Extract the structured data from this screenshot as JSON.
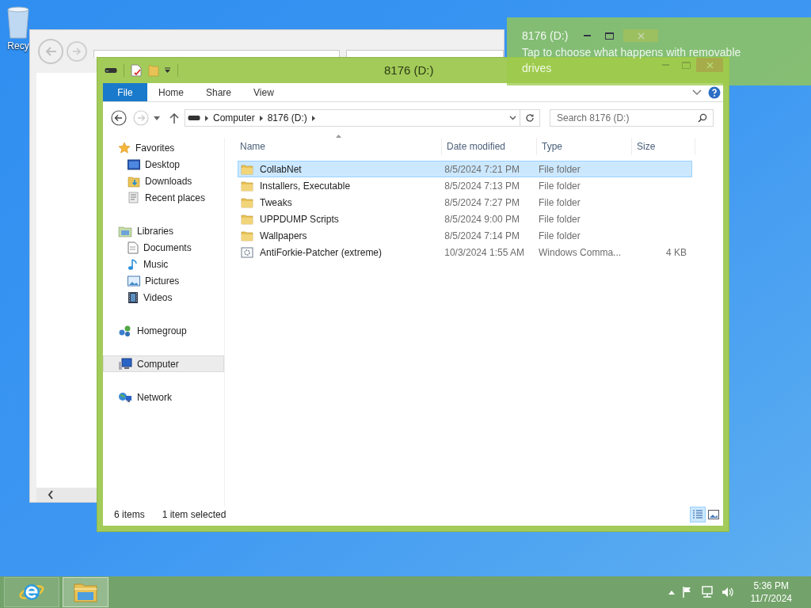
{
  "desktop_icons": [
    {
      "label": "Recy"
    }
  ],
  "explorer": {
    "title": "8176 (D:)",
    "ribbon_tabs": [
      {
        "label": "File",
        "kind": "file"
      },
      {
        "label": "Home",
        "kind": "tab"
      },
      {
        "label": "Share",
        "kind": "tab"
      },
      {
        "label": "View",
        "kind": "tab"
      }
    ],
    "address": [
      "Computer",
      "8176 (D:)"
    ],
    "search": {
      "placeholder": "Search 8176 (D:)"
    },
    "navigation": [
      {
        "label": "Favorites",
        "kind": "star",
        "selected": false,
        "children": [
          {
            "label": "Desktop",
            "kind": "desktop",
            "selected": false
          },
          {
            "label": "Downloads",
            "kind": "downloads",
            "selected": false
          },
          {
            "label": "Recent places",
            "kind": "recent",
            "selected": false
          }
        ]
      },
      {
        "label": "Libraries",
        "kind": "library",
        "selected": false,
        "children": [
          {
            "label": "Documents",
            "kind": "document",
            "selected": false
          },
          {
            "label": "Music",
            "kind": "music",
            "selected": false
          },
          {
            "label": "Pictures",
            "kind": "pictures",
            "selected": false
          },
          {
            "label": "Videos",
            "kind": "videos",
            "selected": false
          }
        ]
      },
      {
        "label": "Homegroup",
        "kind": "homegroup",
        "selected": false
      },
      {
        "label": "Computer",
        "kind": "computer",
        "selected": true
      },
      {
        "label": "Network",
        "kind": "network",
        "selected": false
      }
    ],
    "columns": [
      "Name",
      "Date modified",
      "Type",
      "Size"
    ],
    "rows": [
      {
        "name": "CollabNet",
        "date": "8/5/2024 7:21 PM",
        "type": "File folder",
        "kind": "folder",
        "selected": true
      },
      {
        "name": "Installers, Executable",
        "date": "8/5/2024 7:13 PM",
        "type": "File folder",
        "kind": "folder",
        "selected": false
      },
      {
        "name": "Tweaks",
        "date": "8/5/2024 7:27 PM",
        "type": "File folder",
        "kind": "folder",
        "selected": false
      },
      {
        "name": "UPPDUMP Scripts",
        "date": "8/5/2024 9:00 PM",
        "type": "File folder",
        "kind": "folder",
        "selected": false
      },
      {
        "name": "Wallpapers",
        "date": "8/5/2024 7:14 PM",
        "type": "File folder",
        "kind": "folder",
        "selected": false
      },
      {
        "name": "AntiForkie-Patcher (extreme)",
        "date": "10/3/2024 1:55 AM",
        "type": "Windows Comma...",
        "size": "4 KB",
        "kind": "script",
        "selected": false
      }
    ],
    "status_bar": {
      "count": "6 items",
      "selection": "1 item selected"
    }
  },
  "notification": {
    "title": "8176 (D:)",
    "message": "Tap to choose what happens with removable drives"
  },
  "taskbar": {
    "apps": [
      {
        "kind": "browser",
        "selected": false
      },
      {
        "kind": "explorer",
        "selected": true
      }
    ],
    "time": "5:36 PM",
    "date": "11/7/2024"
  }
}
